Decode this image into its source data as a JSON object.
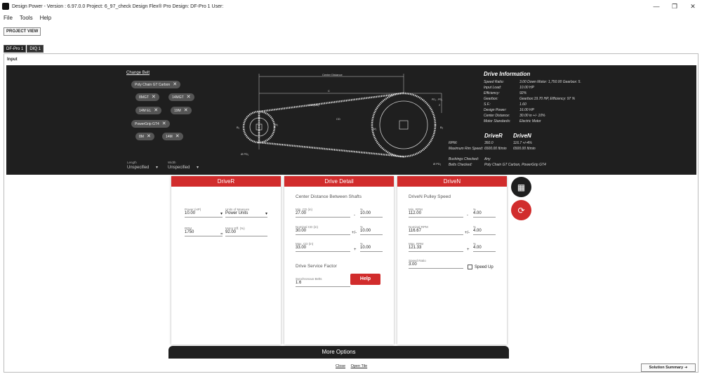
{
  "window": {
    "title": "Design Power - Version : 6.97.0.0 Project: 6_97_check Design Flex® Pro Design: DF-Pro 1 User:",
    "minimize": "—",
    "restore": "❐",
    "close": "✕"
  },
  "menu": [
    "File",
    "Tools",
    "Help"
  ],
  "project_view": "PROJECT VIEW",
  "tabs": [
    "DF-Pro 1",
    "DIQ 1"
  ],
  "input_label": "Input",
  "belt": {
    "change_label": "Change Belt",
    "chips": [
      "Poly Chain GT Carbon",
      "8MGT",
      "14MGT",
      "14M EL",
      "19M",
      "PowerGrip GT4",
      "8M",
      "14M"
    ],
    "chip_remove": "✕",
    "length_label": "Length",
    "length_value": "Unspecified",
    "width_label": "Width",
    "width_value": "Unspecified",
    "dropdown_arrow": "▾"
  },
  "diagram_labels": {
    "center_distance": "Center Distance",
    "c": "C",
    "l_tol": "± tol (belt)",
    "cd": "CD",
    "pd_diff": "PD₁ - PD₂",
    "two": "2",
    "b1": "B₁",
    "b2": "B₂",
    "w1": "W₁",
    "w2": "W₂",
    "od1": "Ø PD₁",
    "od2": "Ø PD₂"
  },
  "drive_info": {
    "title": "Drive Information",
    "rows": [
      {
        "k": "Speed Ratio:",
        "v": "3.00 Down  Motor: 1,750.00  Gearbox: 5."
      },
      {
        "k": "Input Load:",
        "v": "10.00 HP"
      },
      {
        "k": "Efficiency:",
        "v": "92%"
      },
      {
        "k": "Gearbox:",
        "v": "Gearbox:19.70 HP, Efficiency: 97 %"
      },
      {
        "k": "S.F.:",
        "v": "1.60"
      },
      {
        "k": "Design Power:",
        "v": "16.00 HP"
      },
      {
        "k": "Center Distance:",
        "v": "30.00 in +/- 10%"
      },
      {
        "k": "Motor Standards:",
        "v": "Electric Motor"
      }
    ],
    "driver_hdr": "DriveR",
    "driven_hdr": "DriveN",
    "rpm_label": "RPM:",
    "rpm_r": "350.0",
    "rpm_n": "116.7 +/-4%",
    "rim_label": "Maximum Rim Speed:",
    "rim_r": "6500.00 ft/min",
    "rim_n": "6500.00 ft/min",
    "bushings_label": "Bushings Checked:",
    "bushings_value": "Any",
    "belts_label": "Belts Checked:",
    "belts_value": "Poly Chain GT Carbon, PowerGrip GT4"
  },
  "driver_card": {
    "title": "DriveR",
    "power_label": "Power (HP)",
    "power_value": "10.00",
    "units_label": "Units of Measure",
    "units_value": "Power Units",
    "rpm_label": "RPM",
    "rpm_value": "1750",
    "eff_label": "Motor Eff. (%)",
    "eff_value": "92.00",
    "eq": "="
  },
  "detail_card": {
    "title": "Drive Detail",
    "section": "Center Distance Between Shafts",
    "min_label": "Min. CD (in)",
    "min_value": "27.00",
    "min_sep": "-",
    "min_pct_label": "%",
    "min_pct": "10.00",
    "nom_label": "Nominal CD (in)",
    "nom_value": "30.00",
    "nom_sep": "+/-",
    "nom_pct_label": "%",
    "nom_pct": "10.00",
    "max_label": "Max. CD (in)",
    "max_value": "33.00",
    "max_sep": "+",
    "max_pct_label": "%",
    "max_pct": "10.00",
    "sf_section": "Drive Service Factor",
    "sf_label": "Synchronous Belts",
    "sf_value": "1.6",
    "help": "Help"
  },
  "driven_card": {
    "title": "DriveN",
    "section": "DriveN Pulley Speed",
    "min_label": "Min. RPM",
    "min_value": "112.00",
    "min_sep": "-",
    "min_pct_label": "%",
    "min_pct": "4.00",
    "nom_label": "Nominal RPM",
    "nom_value": "116.67",
    "nom_sep": "+/-",
    "nom_pct_label": "%",
    "nom_pct": "4.00",
    "max_label": "Max. RPM",
    "max_value": "121.33",
    "max_sep": "+",
    "max_pct_label": "%",
    "max_pct": "4.00",
    "ratio_label": "Speed Ratio",
    "ratio_value": "3.00",
    "speed_up": "Speed Up"
  },
  "fab": {
    "calc": "▦",
    "refresh": "⟳"
  },
  "more_options": "More Options",
  "links": {
    "close": "Close",
    "open_tile": "Open Tile"
  },
  "solution_summary": "Solution Summary ➜",
  "colors": {
    "accent": "#d12c2c",
    "dark": "#1f1f1f"
  }
}
